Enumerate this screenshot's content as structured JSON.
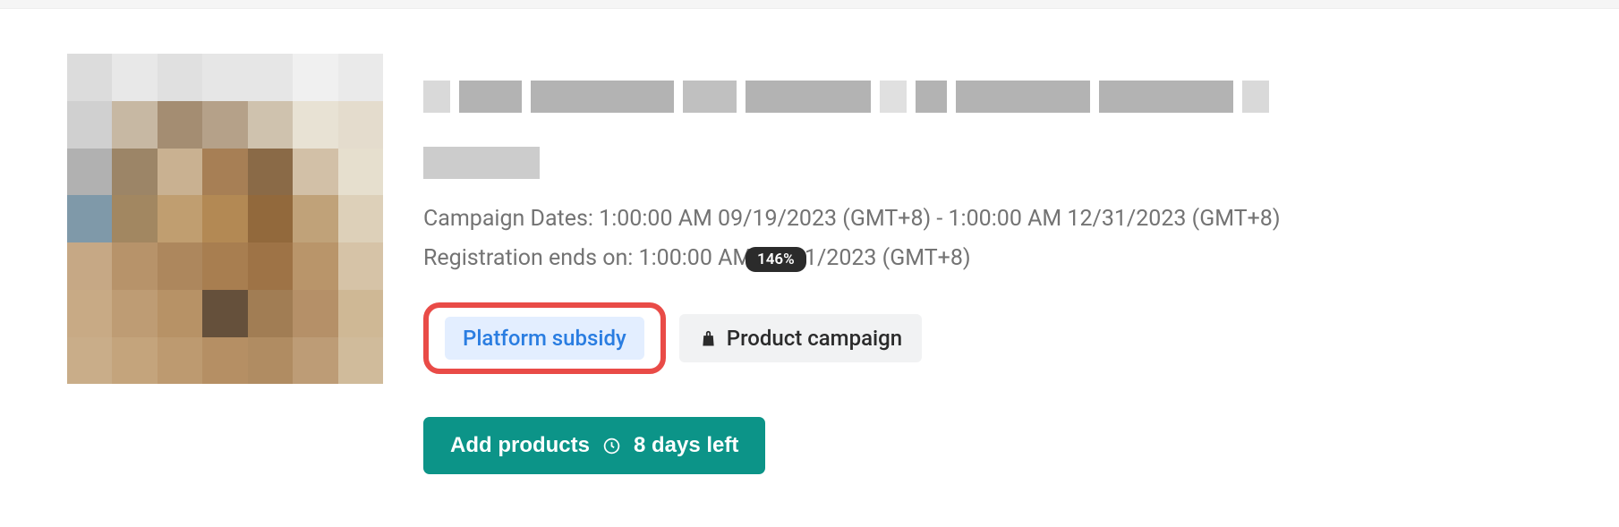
{
  "campaign": {
    "dates_label": "Campaign Dates: 1:00:00 AM 09/19/2023 (GMT+8) - 1:00:00 AM 12/31/2023 (GMT+8)",
    "registration_label": "Registration ends on: 1:00:00 AM 12/31/2023 (GMT+8)"
  },
  "tags": {
    "subsidy": "Platform subsidy",
    "product_campaign": "Product campaign"
  },
  "action": {
    "add_products": "Add products",
    "days_left": "8 days left"
  },
  "zoom": "146%"
}
